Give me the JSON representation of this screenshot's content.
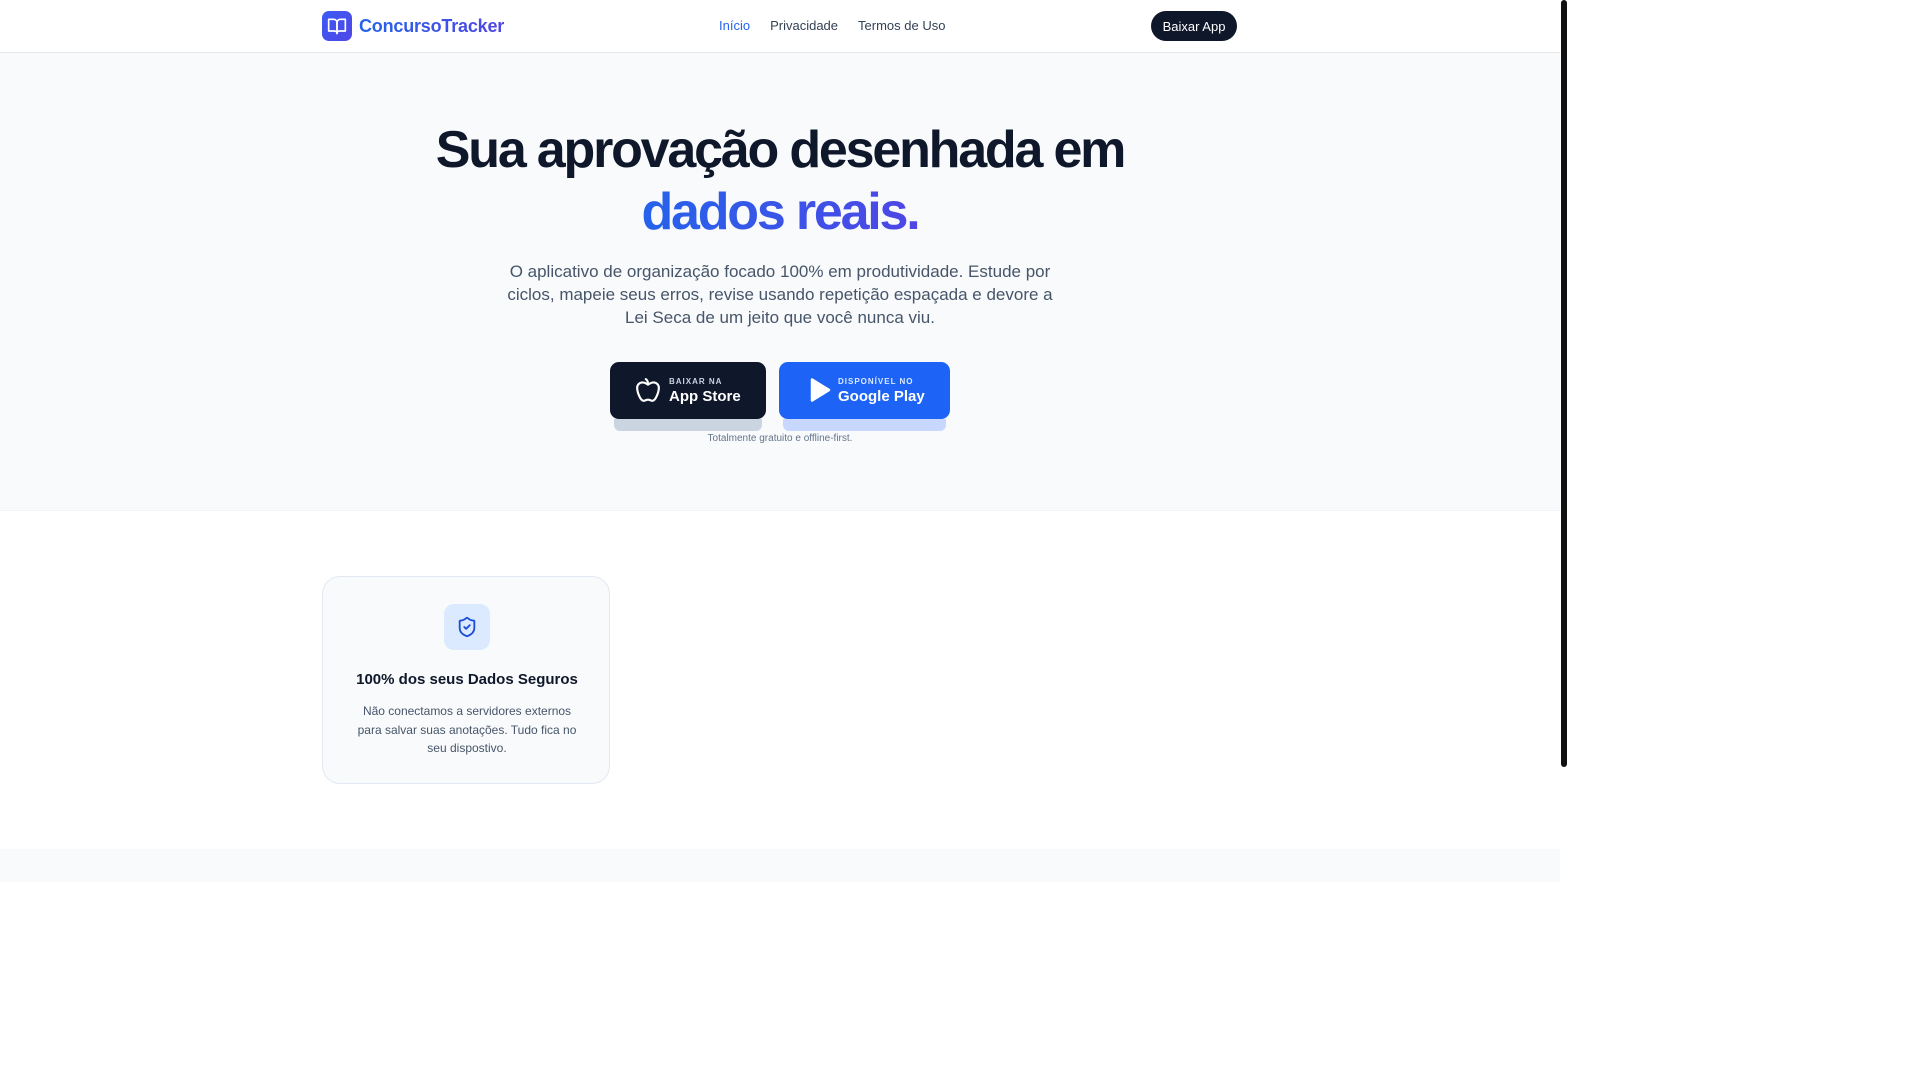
{
  "nav": {
    "brand": "ConcursoTracker",
    "links": [
      "Início",
      "Privacidade",
      "Termos de Uso"
    ],
    "active_link": "Início",
    "cta": "Baixar App"
  },
  "hero": {
    "title_line1": "Sua aprovação desenhada em",
    "title_line2": "dados reais.",
    "subtitle": "O aplicativo de organização focado 100% em produtividade. Estude por ciclos, mapeie seus erros, revise usando repetição espaçada e devore a Lei Seca de um jeito que você nunca viu.",
    "app_store": {
      "small": "BAIXAR NA",
      "big": "App Store",
      "icon": "apple-icon"
    },
    "google_play": {
      "small": "DISPONÍVEL NO",
      "big": "Google Play",
      "icon": "play-icon"
    },
    "note": "Totalmente gratuito e offline-first."
  },
  "features": [
    {
      "icon": "shield-check-icon",
      "title": "100% dos seus Dados Seguros",
      "text": "Não conectamos a servidores externos para salvar suas anotações. Tudo fica no seu dispostivo."
    }
  ],
  "colors": {
    "accent": "#2563eb",
    "accent_gradient_end": "#4f46e5",
    "dark": "#0f172a",
    "google_button": "#1d63f5"
  }
}
